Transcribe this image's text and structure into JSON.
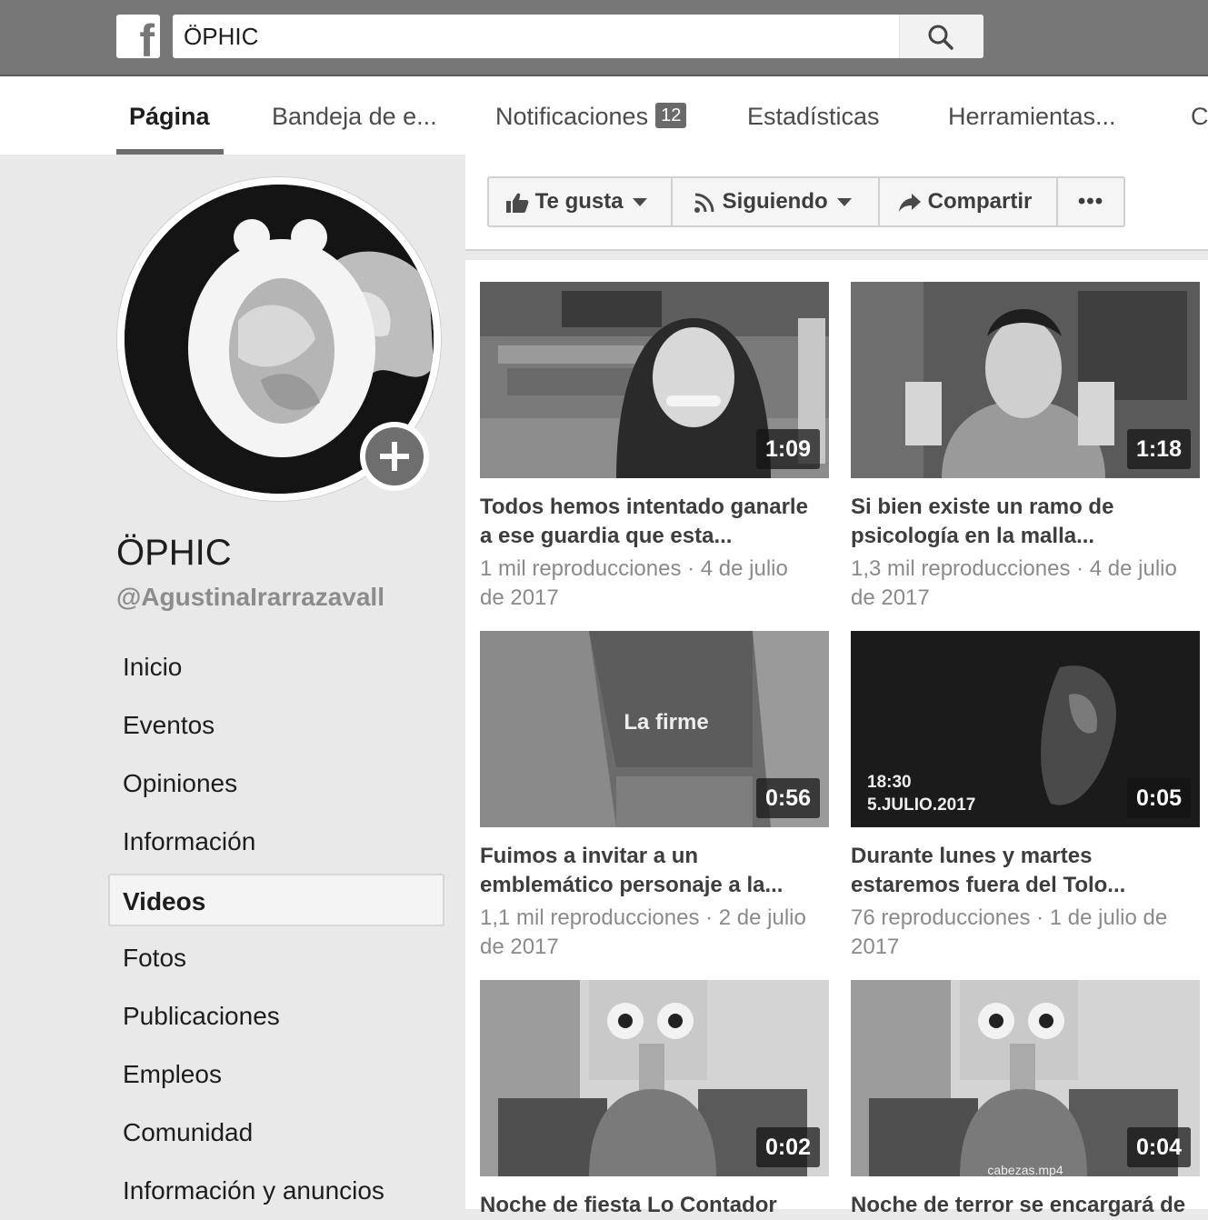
{
  "header": {
    "logo_letter": "f",
    "search_value": "ÖPHIC"
  },
  "tabs": [
    {
      "label": "Página"
    },
    {
      "label": "Bandeja de e..."
    },
    {
      "label": "Notificaciones",
      "badge": "12"
    },
    {
      "label": "Estadísticas"
    },
    {
      "label": "Herramientas..."
    },
    {
      "label": "C"
    }
  ],
  "profile": {
    "name": "ÖPHIC",
    "handle": "@AgustinaIrarrazavall"
  },
  "sidebar": {
    "items": [
      {
        "label": "Inicio"
      },
      {
        "label": "Eventos"
      },
      {
        "label": "Opiniones"
      },
      {
        "label": "Información"
      },
      {
        "label": "Videos",
        "active": true
      },
      {
        "label": "Fotos"
      },
      {
        "label": "Publicaciones"
      },
      {
        "label": "Empleos"
      },
      {
        "label": "Comunidad"
      },
      {
        "label": "Información y anuncios"
      }
    ]
  },
  "actions": {
    "like_label": "Te gusta",
    "follow_label": "Siguiendo",
    "share_label": "Compartir",
    "more_label": "•••"
  },
  "videos": [
    {
      "duration": "1:09",
      "title_line1": "Todos hemos intentado ganarle",
      "title_line2": "a ese guardia que esta...",
      "meta_line1": "1 mil reproducciones · 4 de julio",
      "meta_line2": "de 2017"
    },
    {
      "duration": "1:18",
      "title_line1": "Si bien existe un ramo de",
      "title_line2": "psicología en la malla...",
      "meta_line1": "1,3 mil reproducciones · 4 de julio",
      "meta_line2": "de 2017"
    },
    {
      "duration": "0:56",
      "overlay": "La firme",
      "title_line1": "Fuimos a invitar a un",
      "title_line2": "emblemático personaje a la...",
      "meta_line1": "1,1 mil reproducciones · 2 de julio",
      "meta_line2": "de 2017"
    },
    {
      "duration": "0:05",
      "overlay_line1": "18:30",
      "overlay_line2": "5.JULIO.2017",
      "title_line1": "Durante lunes y martes",
      "title_line2": "estaremos fuera del Tolo...",
      "meta_line1": "76 reproducciones · 1 de julio de",
      "meta_line2": "2017"
    },
    {
      "duration": "0:02",
      "title_line1": "Noche de fiesta Lo Contador"
    },
    {
      "duration": "0:04",
      "overlay": "cabezas.mp4",
      "title_line1": "Noche de terror se encargará de"
    }
  ],
  "colors": {
    "topbar": "#777777",
    "badge": "#6a6a6a",
    "sidebar_bg": "#e9e9e9"
  }
}
